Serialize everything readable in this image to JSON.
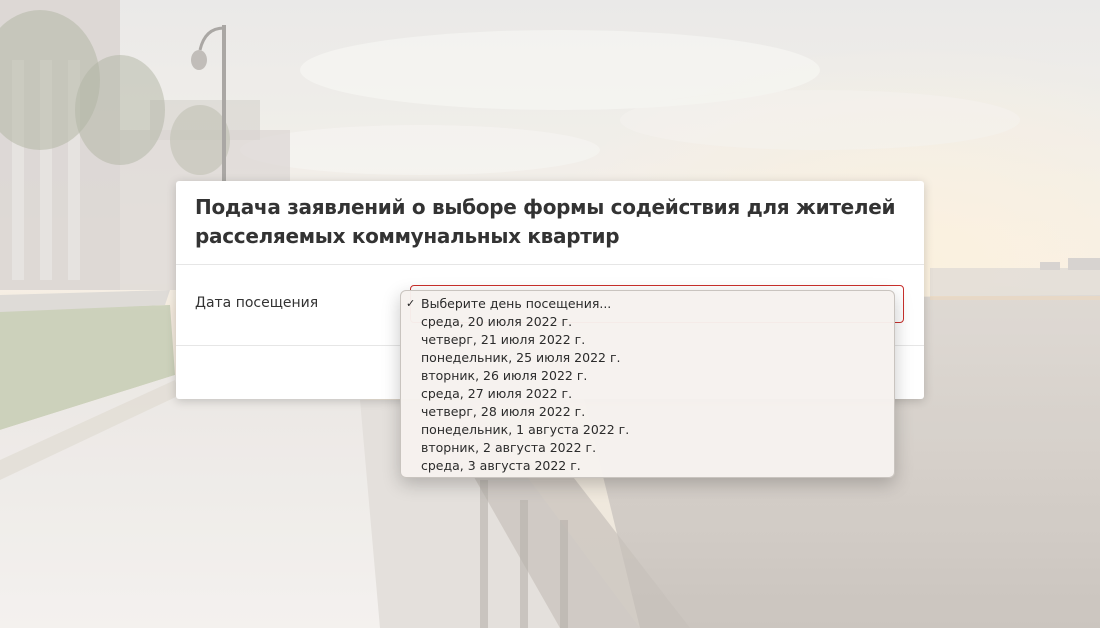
{
  "form": {
    "title": "Подача заявлений о выборе формы содействия для жителей расселяемых коммунальных квартир",
    "field_label": "Дата посещения"
  },
  "dropdown": {
    "selected_index": 0,
    "check_glyph": "✓",
    "options": [
      "Выберите день посещения...",
      "среда, 20 июля 2022 г.",
      "четверг, 21 июля 2022 г.",
      "понедельник, 25 июля 2022 г.",
      "вторник, 26 июля 2022 г.",
      "среда, 27 июля 2022 г.",
      "четверг, 28 июля 2022 г.",
      "понедельник, 1 августа 2022 г.",
      "вторник, 2 августа 2022 г.",
      "среда, 3 августа 2022 г."
    ]
  },
  "colors": {
    "error_border": "#c9302c",
    "title_text": "#333333"
  }
}
